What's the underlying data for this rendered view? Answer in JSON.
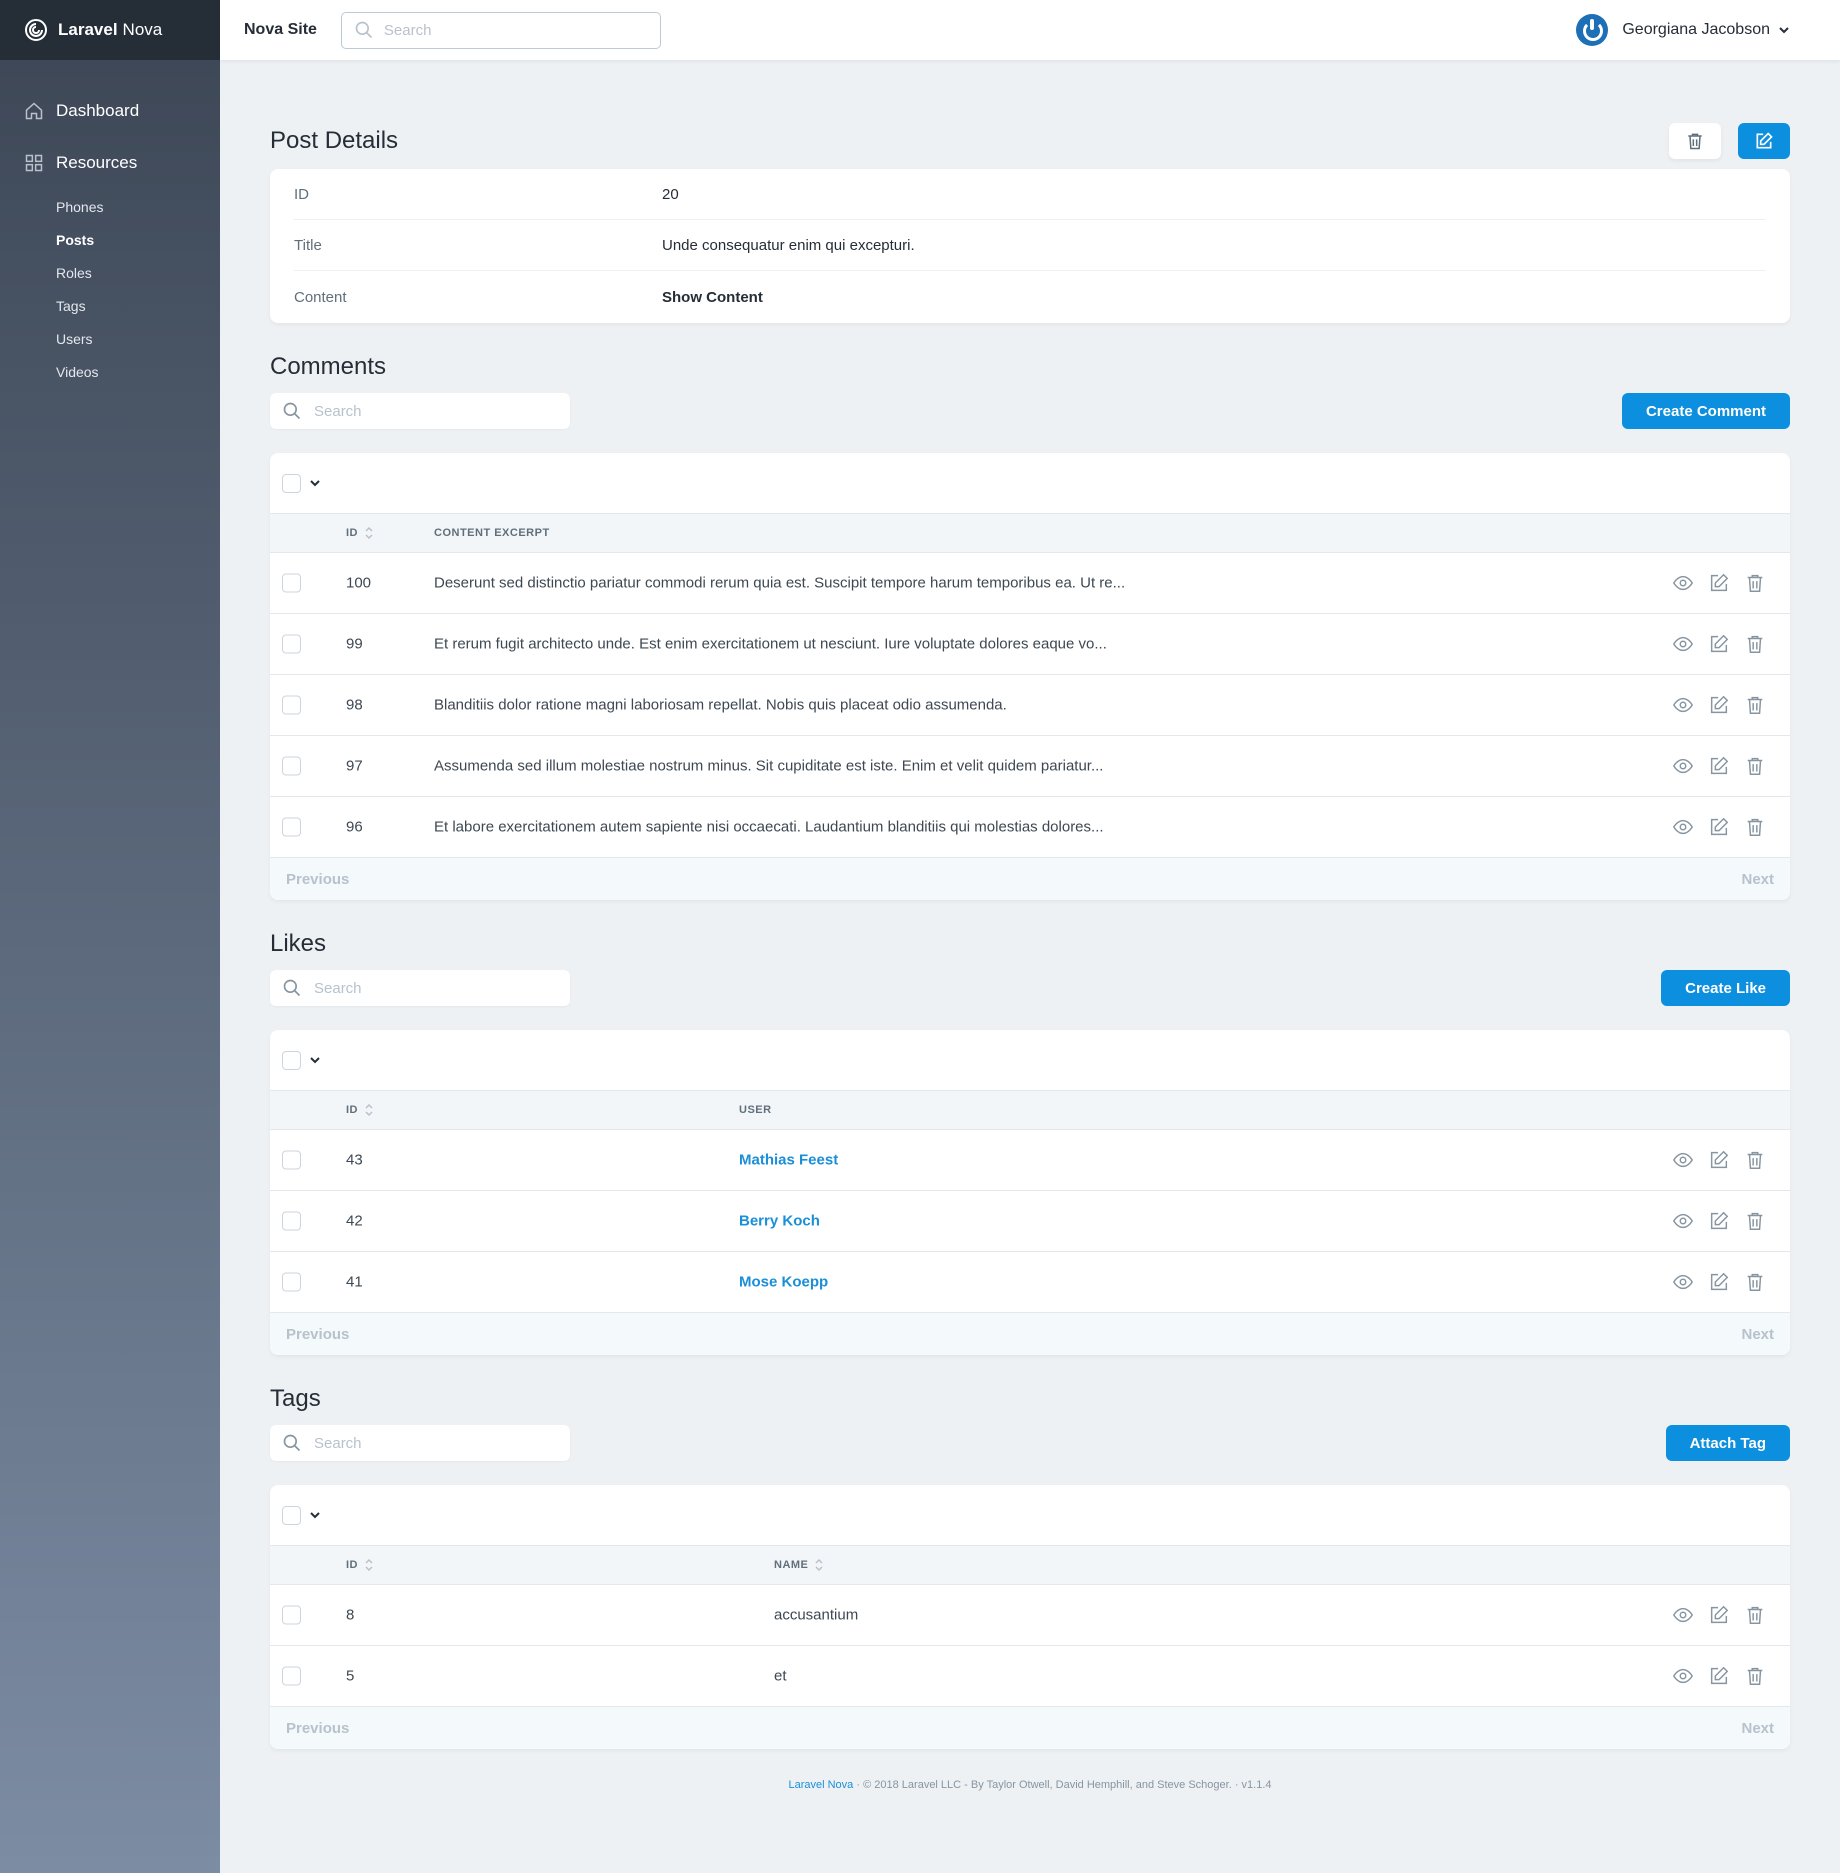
{
  "brand": {
    "bold": "Laravel",
    "rest": "Nova"
  },
  "sidebar": {
    "dashboard": "Dashboard",
    "resources": "Resources",
    "items": [
      {
        "label": "Phones",
        "active": false
      },
      {
        "label": "Posts",
        "active": true
      },
      {
        "label": "Roles",
        "active": false
      },
      {
        "label": "Tags",
        "active": false
      },
      {
        "label": "Users",
        "active": false
      },
      {
        "label": "Videos",
        "active": false
      }
    ]
  },
  "header": {
    "site_name": "Nova Site",
    "search_placeholder": "Search",
    "user_name": "Georgiana Jacobson"
  },
  "detail": {
    "title": "Post Details",
    "fields": [
      {
        "label": "ID",
        "value": "20"
      },
      {
        "label": "Title",
        "value": "Unde consequatur enim qui excepturi."
      },
      {
        "label": "Content",
        "value": "Show Content"
      }
    ]
  },
  "comments": {
    "title": "Comments",
    "search_placeholder": "Search",
    "create_label": "Create Comment",
    "columns": [
      "ID",
      "CONTENT EXCERPT"
    ],
    "rows": [
      {
        "id": "100",
        "text": "Deserunt sed distinctio pariatur commodi rerum quia est. Suscipit tempore harum temporibus ea. Ut re..."
      },
      {
        "id": "99",
        "text": "Et rerum fugit architecto unde. Est enim exercitationem ut nesciunt. Iure voluptate dolores eaque vo..."
      },
      {
        "id": "98",
        "text": "Blanditiis dolor ratione magni laboriosam repellat. Nobis quis placeat odio assumenda."
      },
      {
        "id": "97",
        "text": "Assumenda sed illum molestiae nostrum minus. Sit cupiditate est iste. Enim et velit quidem pariatur..."
      },
      {
        "id": "96",
        "text": "Et labore exercitationem autem sapiente nisi occaecati. Laudantium blanditiis qui molestias dolores..."
      }
    ],
    "prev": "Previous",
    "next": "Next"
  },
  "likes": {
    "title": "Likes",
    "search_placeholder": "Search",
    "create_label": "Create Like",
    "columns": [
      "ID",
      "USER"
    ],
    "rows": [
      {
        "id": "43",
        "text": "Mathias Feest"
      },
      {
        "id": "42",
        "text": "Berry Koch"
      },
      {
        "id": "41",
        "text": "Mose Koepp"
      }
    ],
    "prev": "Previous",
    "next": "Next"
  },
  "tags": {
    "title": "Tags",
    "search_placeholder": "Search",
    "create_label": "Attach Tag",
    "columns": [
      "ID",
      "NAME"
    ],
    "rows": [
      {
        "id": "8",
        "text": "accusantium"
      },
      {
        "id": "5",
        "text": "et"
      }
    ],
    "prev": "Previous",
    "next": "Next"
  },
  "footer": {
    "link": "Laravel Nova",
    "text": "© 2018 Laravel LLC - By Taylor Otwell, David Hemphill, and Steve Schoger.",
    "version": "v1.1.4"
  },
  "colors": {
    "primary": "#0d8fe0",
    "sidebar_dark": "#252d37",
    "link": "#1a8fd8"
  }
}
